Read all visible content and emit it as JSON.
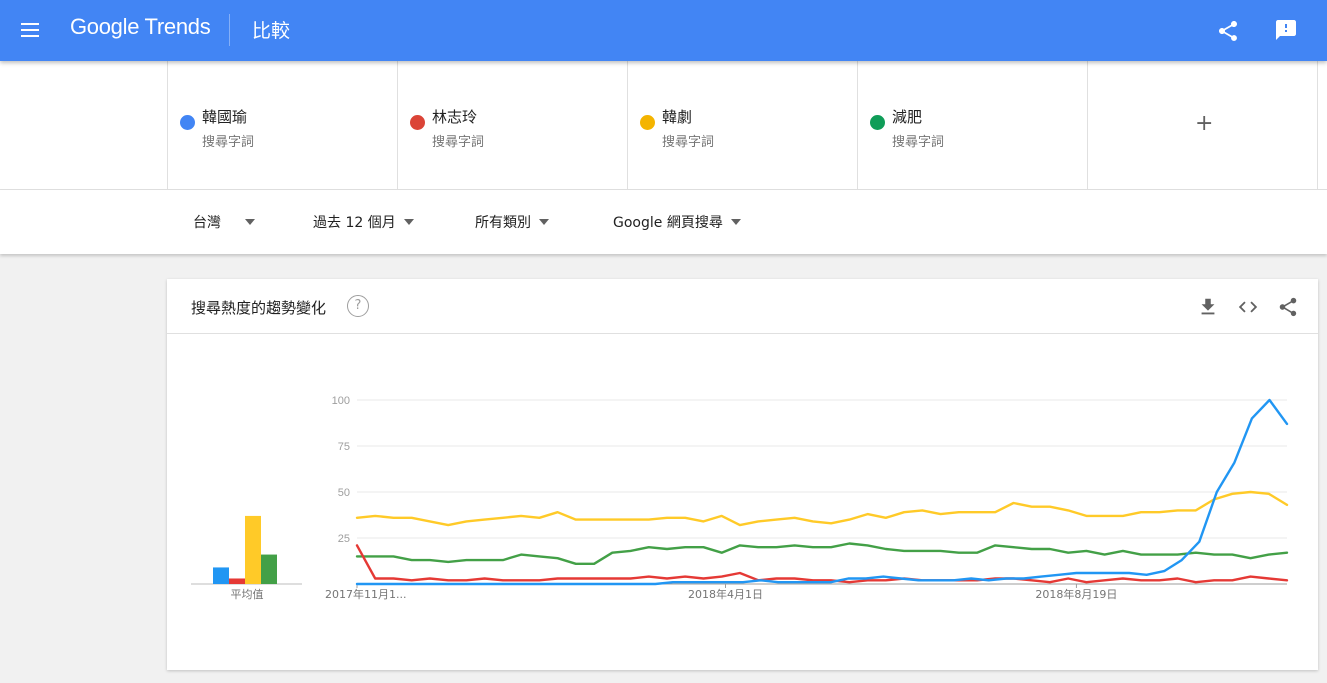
{
  "header": {
    "menu_icon": "menu-icon",
    "logo_text": "Google Trends",
    "page_name": "比較",
    "share_icon": "share-icon",
    "feedback_icon": "feedback-icon",
    "bar_color": "#4285f4"
  },
  "terms": [
    {
      "name": "韓國瑜",
      "sub": "搜尋字詞",
      "color": "#4285f4"
    },
    {
      "name": "林志玲",
      "sub": "搜尋字詞",
      "color": "#db4437"
    },
    {
      "name": "韓劇",
      "sub": "搜尋字詞",
      "color": "#f4b400"
    },
    {
      "name": "減肥",
      "sub": "搜尋字詞",
      "color": "#0f9d58"
    }
  ],
  "add_term_label": "+",
  "filters": {
    "region": "台灣",
    "time_range": "過去 12 個月",
    "category": "所有類別",
    "search_type": "Google 網頁搜尋"
  },
  "card": {
    "title": "搜尋熱度的趨勢變化",
    "help_label": "?",
    "download_icon": "download-icon",
    "embed_icon": "embed-code-icon",
    "share_icon": "share-icon"
  },
  "chart_data": [
    {
      "type": "bar",
      "xlabel": "平均值",
      "categories": [
        "韓國瑜",
        "林志玲",
        "韓劇",
        "減肥"
      ],
      "values": [
        9,
        3,
        37,
        16
      ],
      "colors": [
        "#2196f3",
        "#e53935",
        "#ffca28",
        "#43a047"
      ],
      "ylim": [
        0,
        100
      ]
    },
    {
      "type": "line",
      "ylim": [
        0,
        100
      ],
      "yticks": [
        100,
        75,
        50,
        25
      ],
      "xtick_labels": [
        {
          "label": "2017年11月1...",
          "index": 0
        },
        {
          "label": "2018年4月1日",
          "index": 21
        },
        {
          "label": "2018年8月19日",
          "index": 41
        }
      ],
      "grid": true,
      "series": [
        {
          "name": "韓國瑜",
          "color": "#2196f3",
          "values": [
            0,
            0,
            0,
            0,
            0,
            0,
            0,
            0,
            0,
            0,
            0,
            0,
            0,
            0,
            0,
            0,
            0,
            0,
            1,
            1,
            1,
            1,
            1,
            2,
            1,
            1,
            1,
            1,
            3,
            3,
            4,
            3,
            2,
            2,
            2,
            3,
            2,
            3,
            3,
            4,
            5,
            6,
            6,
            6,
            6,
            5,
            7,
            13,
            23,
            50,
            66,
            90,
            100,
            87
          ]
        },
        {
          "name": "林志玲",
          "color": "#e53935",
          "values": [
            21,
            3,
            3,
            2,
            3,
            2,
            2,
            3,
            2,
            2,
            2,
            3,
            3,
            3,
            3,
            3,
            4,
            3,
            4,
            3,
            4,
            6,
            2,
            3,
            3,
            2,
            2,
            1,
            2,
            2,
            3,
            2,
            2,
            2,
            2,
            3,
            3,
            2,
            1,
            3,
            1,
            2,
            3,
            2,
            2,
            3,
            1,
            2,
            2,
            4,
            3,
            2
          ]
        },
        {
          "name": "韓劇",
          "color": "#ffca28",
          "values": [
            36,
            37,
            36,
            36,
            34,
            32,
            34,
            35,
            36,
            37,
            36,
            39,
            35,
            35,
            35,
            35,
            35,
            36,
            36,
            34,
            37,
            32,
            34,
            35,
            36,
            34,
            33,
            35,
            38,
            36,
            39,
            40,
            38,
            39,
            39,
            39,
            44,
            42,
            42,
            40,
            37,
            37,
            37,
            39,
            39,
            40,
            40,
            46,
            49,
            50,
            49,
            43
          ]
        },
        {
          "name": "減肥",
          "color": "#43a047",
          "values": [
            15,
            15,
            15,
            13,
            13,
            12,
            13,
            13,
            13,
            16,
            15,
            14,
            11,
            11,
            17,
            18,
            20,
            19,
            20,
            20,
            17,
            21,
            20,
            20,
            21,
            20,
            20,
            22,
            21,
            19,
            18,
            18,
            18,
            17,
            17,
            21,
            20,
            19,
            19,
            17,
            18,
            16,
            18,
            16,
            16,
            16,
            17,
            16,
            16,
            14,
            16,
            17
          ]
        }
      ]
    }
  ]
}
